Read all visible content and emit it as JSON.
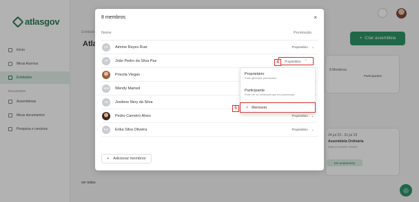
{
  "app": {
    "logo_text": "atlasgov",
    "nav_items": [
      "Início",
      "Meus Acervos",
      "Entidades"
    ],
    "nav_section": "Documentos",
    "nav_items2": [
      "Assembleias",
      "Meus documentos",
      "Pesquisa e cenários"
    ],
    "breadcrumb": "Entidades",
    "page_title": "Atla",
    "create_button": "Criar assembleia",
    "members_count_label": "8 Membros",
    "participants_label": "Participantes",
    "event_date": "24 jul 23 - 31 jul 23",
    "event_title": "Assembleia Ordinária",
    "event_subtitle": "Atlas (Conselho Gestor)",
    "event_status": "Em andamento",
    "see_all": "ver todas"
  },
  "modal": {
    "title": "8 membros",
    "close_icon": "×",
    "col_name": "Nome",
    "col_permission": "Permissão",
    "members": [
      {
        "initials": "AR",
        "name": "Aimme Reyes Ruiz",
        "permission": "Proprietário",
        "chevron": "⌄"
      },
      {
        "initials": "JP",
        "name": "João Pedro da Silva Paz",
        "permission": "Proprietário",
        "chevron": "⌃"
      },
      {
        "initials": "",
        "name": "Priscila Viegas",
        "permission": "",
        "chevron": ""
      },
      {
        "initials": "WM",
        "name": "Wendy Marisol",
        "permission": "",
        "chevron": ""
      },
      {
        "initials": "JS",
        "name": "Josilene Nery da Silva",
        "permission": "",
        "chevron": ""
      },
      {
        "initials": "",
        "name": "Pedro Carneiro Alves",
        "permission": "Proprietário",
        "chevron": "⌄"
      },
      {
        "initials": "EO",
        "name": "Erika Silva Oliveira",
        "permission": "Proprietário",
        "chevron": "⌄"
      }
    ],
    "add_members": "Adicionar membros",
    "add_icon": "+"
  },
  "dropdown": {
    "owner_title": "Proprietário",
    "owner_desc": "Pode gerenciar permissões",
    "participant_title": "Participante",
    "participant_desc": "Pode ver os conteúdos que tem permissão",
    "remove_label": "Remover",
    "remove_icon": "×"
  },
  "annotations": {
    "step4": "4",
    "step5": "5"
  },
  "colors": {
    "accent": "#2f9467",
    "highlight": "#d42c2c"
  }
}
